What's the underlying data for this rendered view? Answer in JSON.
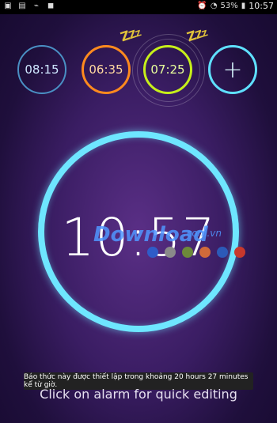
{
  "status_bar": {
    "battery_percent": "53%",
    "time": "10:57",
    "icons": [
      "gallery-icon",
      "image-icon",
      "usb-icon",
      "bag-icon",
      "alarm-icon",
      "wifi-icon",
      "battery-icon"
    ]
  },
  "alarms": [
    {
      "time": "08:15",
      "color": "#4a90c4"
    },
    {
      "time": "06:35",
      "color": "#ff8a1e"
    },
    {
      "time": "07:25",
      "color": "#c7ef1a"
    }
  ],
  "add_alarm_label": "+",
  "clock": {
    "time": "10:57"
  },
  "theme_colors": [
    "#2f5cc8",
    "#8a8a8a",
    "#6d8a3a",
    "#d06a3a",
    "#2c5ab8",
    "#c8382c"
  ],
  "watermark": {
    "main": "Download",
    "sub": ".com.vn"
  },
  "toast": "Báo thức này được thiết lập trong khoảng 20 hours 27 minutes kể từ giờ.",
  "hint": "Click on alarm for quick editing"
}
